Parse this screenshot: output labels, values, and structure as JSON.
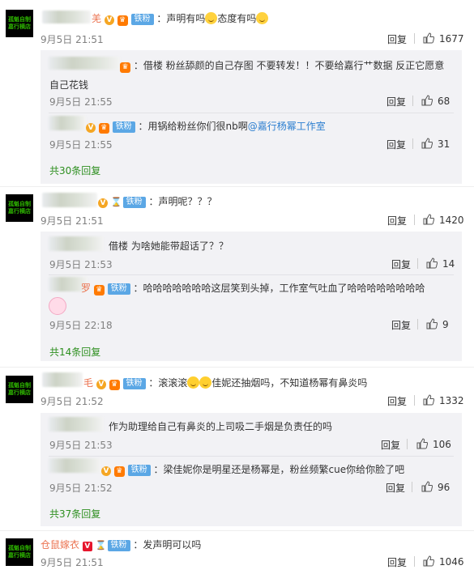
{
  "avatar_text": [
    "孤魁自制",
    "嘉行横店"
  ],
  "fans_badge": "铁粉",
  "reply_label": "回复",
  "comments": [
    {
      "username": "羌",
      "text": "：声明有吗",
      "text2": "态度有吗",
      "time": "9月5日 21:51",
      "likes": "1677",
      "replies": [
        {
          "text": "：借楼 粉丝舔颜的自己存图 不要转发！！不要给嘉行艹数据 反正它愿意",
          "text_line2": "自己花钱",
          "time": "9月5日 21:55",
          "likes": "68"
        },
        {
          "text": "：用锅给粉丝你们很nb啊",
          "mention": "@嘉行杨幂工作室",
          "time": "9月5日 21:55",
          "likes": "31"
        }
      ],
      "more": "共30条回复"
    },
    {
      "text": "：声明呢？？？",
      "time": "9月5日 21:51",
      "likes": "1420",
      "replies": [
        {
          "text": "借楼 为啥她能带超话了？？",
          "time": "9月5日 21:53",
          "likes": "14"
        },
        {
          "username": "罗",
          "text": "：哈哈哈哈哈哈哈这层笑到头掉，工作室气吐血了哈哈哈哈哈哈哈哈",
          "time": "9月5日 22:18",
          "likes": "9"
        }
      ],
      "more": "共14条回复"
    },
    {
      "username": "毛",
      "text": "：滚滚滚",
      "text2": "佳妮还抽烟吗，不知道杨幂有鼻炎吗",
      "time": "9月5日 21:52",
      "likes": "1332",
      "replies": [
        {
          "text": "作为助理给自己有鼻炎的上司吸二手烟是负责任的吗",
          "time": "9月5日 21:53",
          "likes": "106"
        },
        {
          "text": "：梁佳妮你是明星还是杨幂是，粉丝频繁cue你给你脸了吧",
          "time": "9月5日 21:52",
          "likes": "96"
        }
      ],
      "more": "共37条回复"
    },
    {
      "username": "仓鼠嫁衣",
      "text": "：发声明可以吗",
      "time": "9月5日 21:51",
      "likes": "1046"
    }
  ]
}
